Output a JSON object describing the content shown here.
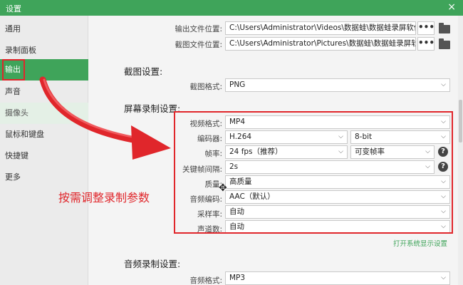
{
  "window": {
    "title": "设置",
    "close_glyph": "×"
  },
  "sidebar": {
    "items": [
      {
        "label": "通用"
      },
      {
        "label": "录制面板"
      },
      {
        "label": "输出"
      },
      {
        "label": "声音"
      },
      {
        "label": "摄像头"
      },
      {
        "label": "鼠标和键盘"
      },
      {
        "label": "快捷键"
      },
      {
        "label": "更多"
      }
    ],
    "active_index": 2
  },
  "output": {
    "output_folder_label": "输出文件位置:",
    "output_folder_value": "C:\\Users\\Administrator\\Videos\\数据蛙\\数据蛙录屏软件",
    "screenshot_folder_label": "截图文件位置:",
    "screenshot_folder_value": "C:\\Users\\Administrator\\Pictures\\数据蛙\\数据蛙录屏软件",
    "browse_label": "•••"
  },
  "screenshot_settings": {
    "heading": "截图设置:",
    "format_label": "截图格式:",
    "format_value": "PNG"
  },
  "screen_recording": {
    "heading": "屏幕录制设置:",
    "video_format_label": "视频格式:",
    "video_format_value": "MP4",
    "encoder_label": "编码器:",
    "encoder_value": "H.264",
    "bit_depth_value": "8-bit",
    "fps_label": "帧率:",
    "fps_value": "24 fps（推荐）",
    "fps_mode_value": "可变帧率",
    "keyframe_label": "关键帧间隔:",
    "keyframe_value": "2s",
    "quality_label": "质量:",
    "quality_value": "高质量",
    "audio_codec_label": "音频编码:",
    "audio_codec_value": "AAC（默认）",
    "sample_rate_label": "采样率:",
    "sample_rate_value": "自动",
    "channels_label": "声道数:",
    "channels_value": "自动",
    "system_display_link": "打开系统显示设置",
    "help_glyph": "?"
  },
  "audio_recording": {
    "heading": "音频录制设置:",
    "format_label": "音频格式:",
    "format_value": "MP3"
  },
  "annotation": {
    "text": "按需调整录制参数"
  },
  "icons": {
    "chevron": "chevron-down-icon",
    "folder": "folder-icon",
    "help": "help-icon",
    "close": "close-icon",
    "move": "move-cursor-icon"
  },
  "colors": {
    "accent_green": "#3fa45a",
    "annotation_red": "#e0262b"
  }
}
